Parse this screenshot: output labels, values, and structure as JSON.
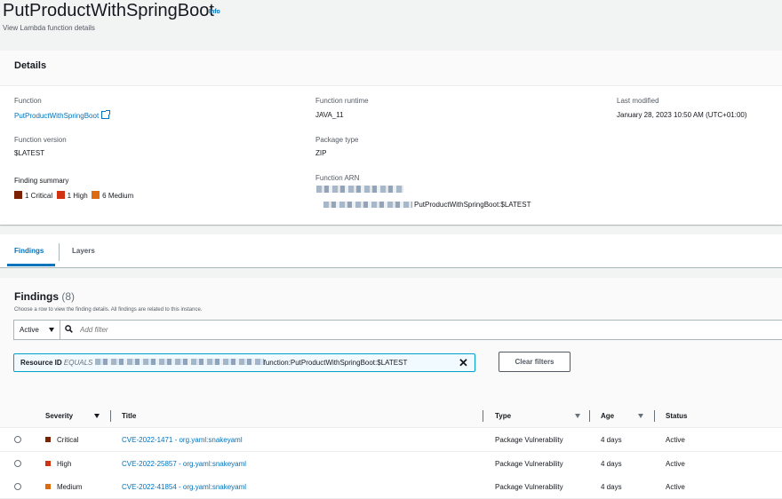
{
  "header": {
    "title": "PutProductWithSpringBoot",
    "info": "Info",
    "subtitle": "View Lambda function details"
  },
  "details": {
    "heading": "Details",
    "function_label": "Function",
    "function_value": "PutProductWithSpringBoot",
    "runtime_label": "Function runtime",
    "runtime_value": "JAVA_11",
    "modified_label": "Last modified",
    "modified_value": "January 28, 2023 10:50 AM (UTC+01:00)",
    "version_label": "Function version",
    "version_value": "$LATEST",
    "package_label": "Package type",
    "package_value": "ZIP",
    "summary_label": "Finding summary",
    "summary": [
      {
        "text": "1 Critical",
        "color": "#7d2105"
      },
      {
        "text": "1 High",
        "color": "#d13212"
      },
      {
        "text": "6 Medium",
        "color": "#dd6b10"
      }
    ],
    "arn_label": "Function ARN",
    "arn_suffix": "PutProductWithSpringBoot:$LATEST"
  },
  "tabs": [
    {
      "label": "Findings",
      "active": true
    },
    {
      "label": "Layers",
      "active": false
    }
  ],
  "findings": {
    "title": "Findings",
    "count": "(8)",
    "description": "Choose a row to view the finding details. All findings are related to this instance.",
    "status_select": "Active",
    "filter_placeholder": "Add filter",
    "token_key": "Resource ID",
    "token_op": "EQUALS",
    "token_suffix": "function:PutProductWithSpringBoot:$LATEST",
    "clear_label": "Clear filters",
    "columns": {
      "severity": "Severity",
      "title": "Title",
      "type": "Type",
      "age": "Age",
      "status": "Status"
    },
    "rows": [
      {
        "severity": "Critical",
        "color": "#7d2105",
        "title": "CVE-2022-1471 - org.yaml:snakeyaml",
        "type": "Package Vulnerability",
        "age": "4 days",
        "status": "Active"
      },
      {
        "severity": "High",
        "color": "#d13212",
        "title": "CVE-2022-25857 - org.yaml:snakeyaml",
        "type": "Package Vulnerability",
        "age": "4 days",
        "status": "Active"
      },
      {
        "severity": "Medium",
        "color": "#dd6b10",
        "title": "CVE-2022-41854 - org.yaml:snakeyaml",
        "type": "Package Vulnerability",
        "age": "4 days",
        "status": "Active"
      }
    ]
  }
}
